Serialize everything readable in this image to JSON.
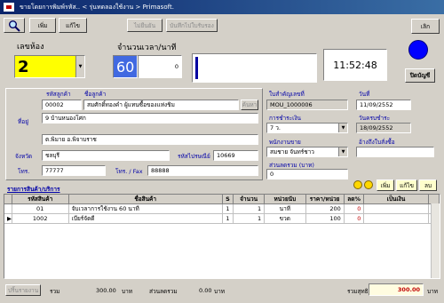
{
  "window": {
    "title": "ขายโดยการพิมพ์รหัส.. < รุ่นทดลองใช้งาน > Primasoft."
  },
  "toolbar": {
    "add_label": "เพิ่ม",
    "edit_label": "แก้ไข",
    "cancel_label": "ไม่ยืนยัน",
    "save_label": "บันทึกไปใบรับรอง",
    "exit_label": "เลิก"
  },
  "room": {
    "label": "เลขห้อง",
    "value": "2"
  },
  "usage": {
    "label": "จำนวนเวลา/นาที",
    "minutes": "60",
    "extra": "0",
    "progress": 0
  },
  "clock": {
    "time": "11:52:48"
  },
  "status": {
    "indicator_color": "#0000ff",
    "checkout_label": "ปิดบัญชี"
  },
  "customer": {
    "code_label": "รหัสลูกค้า",
    "code": "00002",
    "name_label": "ชื่อลูกค้า",
    "name": "สมศักดิ์ทองคำ ผู้แทนซื้อของแห่งชิม",
    "search_label": "ค้นหา",
    "address_label": "ที่อยู่",
    "address1": "9 บ้านหนองโศก",
    "address2": "ต.พิมาย  อ.พิจาบราช",
    "province_label": "จังหวัด",
    "province": "ชลบุรี",
    "postcode_label": "รหัสไปรษณีย์",
    "postcode": "10669",
    "phone_label": "โทร.",
    "phone": "77777",
    "fax_label": "โทร. / Fax",
    "fax": "88888"
  },
  "document": {
    "contract_label": "ใบสำคัญเลขที่",
    "contract": "MOU_1000006",
    "date_label": "วันที่",
    "date": "11/09/2552",
    "payment_label": "การชำระเงิน",
    "payment": "7 ว.",
    "due_label": "วันครบชำระ",
    "due": "18/09/2552",
    "salesman_label": "พนักงานขาย",
    "salesman": "สมชาย จันทร์ชาว",
    "ref_label": "อ้างถึงใบสั่งซื้อ",
    "ref": "",
    "discount_label": "ส่วนลดรวม (บาท)",
    "discount": "0"
  },
  "items_section": {
    "title": "รายการสินค้า/บริการ",
    "add_label": "เพิ่ม",
    "edit_label": "แก้ไข",
    "delete_label": "ลบ",
    "columns": [
      "รหัสสินค้า",
      "ชื่อสินค้า",
      "S",
      "จำนวน",
      "หน่วยนับ",
      "ราคา/หน่วย",
      "ลด%",
      "เป็นเงิน"
    ],
    "rows": [
      {
        "code": "01",
        "name": "จับเวลาการใช้งาน 60 นาที",
        "s": "1",
        "qty": "1",
        "unit": "นาที",
        "price": "200",
        "disc": "0",
        "amount": "200.00"
      },
      {
        "code": "1002",
        "name": "เบียร์จัดดี",
        "s": "1",
        "qty": "1",
        "unit": "ขวด",
        "price": "100",
        "disc": "0",
        "amount": "100.00"
      }
    ]
  },
  "footer": {
    "print_label": "ปริ้นรายงาน",
    "total_label": "รวม",
    "total": "300.00",
    "unit1": "บาท",
    "discount_label": "ส่วนลดรวม",
    "discount": "0.00",
    "unit2": "บาท",
    "net_label": "รวมสุทธิ",
    "net": "300.00",
    "unit3": "บาท"
  }
}
